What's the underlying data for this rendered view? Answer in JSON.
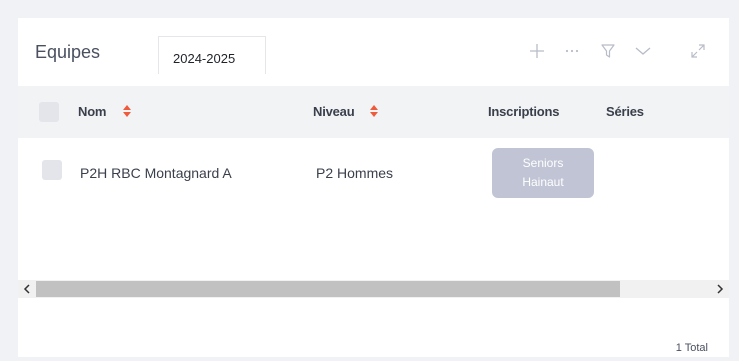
{
  "header": {
    "title": "Equipes",
    "season": "2024-2025",
    "tools": [
      "add-icon",
      "more-icon",
      "filter-icon",
      "chevron-down-icon",
      "expand-icon"
    ]
  },
  "table": {
    "columns": [
      "Nom",
      "Niveau",
      "Inscriptions",
      "Séries"
    ],
    "rows": [
      {
        "nom": "P2H RBC Montagnard A",
        "niveau": "P2 Hommes",
        "inscriptions": [
          "Seniors",
          "Hainaut"
        ],
        "series": ""
      }
    ]
  },
  "footer": {
    "total": "1 Total"
  },
  "colors": {
    "sort_accent": "#f05a3c",
    "icon": "#b8bcc8",
    "tag_bg": "#c0c4d4",
    "header_bg": "#f2f3f5",
    "page_bg": "#f0f2f5"
  }
}
